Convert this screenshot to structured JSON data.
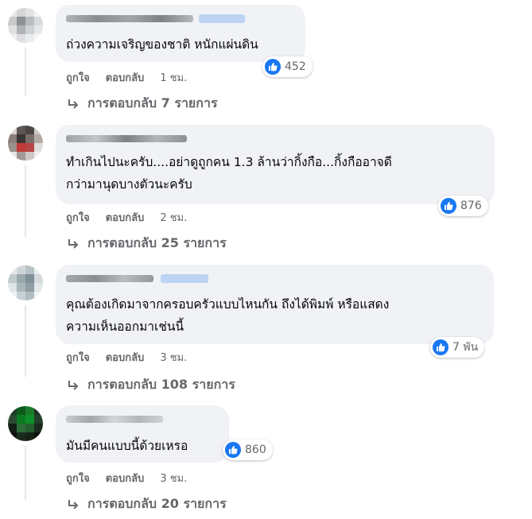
{
  "comments": [
    {
      "text_lines": [
        "ถ่วงความเจริญของชาติ หนักแผ่นดิน"
      ],
      "likes": "452",
      "like_label": "ถูกใจ",
      "reply_label": "ตอบกลับ",
      "time": "1 ชม.",
      "replies": "การตอบกลับ 7 รายการ"
    },
    {
      "text_lines": [
        "ทำเกินไปนะครับ....อย่าดูถูกคน 1.3 ล้านว่ากิ้งกือ...กิ้งกืออาจดี",
        "กว่ามานุดบางตัวนะครับ"
      ],
      "likes": "876",
      "like_label": "ถูกใจ",
      "reply_label": "ตอบกลับ",
      "time": "2 ชม.",
      "replies": "การตอบกลับ 25 รายการ"
    },
    {
      "text_lines": [
        "คุณต้องเกิดมาจากครอบครัวแบบไหนกัน ถึงได้พิมพ์ หรือแสดง",
        "ความเห็นออกมาเช่นนี้"
      ],
      "likes": "7 พัน",
      "like_label": "ถูกใจ",
      "reply_label": "ตอบกลับ",
      "time": "3 ชม.",
      "replies": "การตอบกลับ 108 รายการ"
    },
    {
      "text_lines": [
        "มันมีคนแบบนี้ด้วยเหรอ"
      ],
      "likes": "860",
      "like_label": "ถูกใจ",
      "reply_label": "ตอบกลับ",
      "time": "3 ชม.",
      "replies": "การตอบกลับ 20 รายการ"
    }
  ],
  "colors": {
    "bubble": "#f0f2f5",
    "meta_text": "#65676b",
    "like_blue": "#1877f2"
  },
  "icons": [
    "like-icon",
    "reply-arrow-icon"
  ]
}
